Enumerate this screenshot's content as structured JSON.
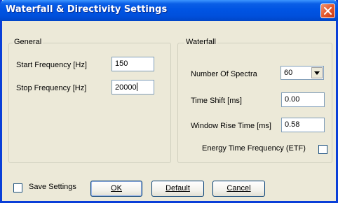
{
  "window": {
    "title": "Waterfall & Directivity Settings"
  },
  "general": {
    "legend": "General",
    "start_frequency_label": "Start Frequency [Hz]",
    "start_frequency_value": "150",
    "stop_frequency_label": "Stop Frequency [Hz]",
    "stop_frequency_value": "20000"
  },
  "waterfall": {
    "legend": "Waterfall",
    "number_of_spectra_label": "Number Of Spectra",
    "number_of_spectra_value": "60",
    "time_shift_label": "Time Shift [ms]",
    "time_shift_value": "0.00",
    "window_rise_time_label": "Window Rise Time [ms]",
    "window_rise_time_value": "0.58",
    "etf_label": "Energy Time Frequency (ETF)",
    "etf_checked": false
  },
  "footer": {
    "save_settings_label": "Save Settings",
    "save_settings_checked": false,
    "ok_label": "OK",
    "default_label": "Default",
    "cancel_label": "Cancel"
  },
  "icons": {
    "close": "close-icon",
    "dropdown": "chevron-down-icon"
  },
  "colors": {
    "titlebar": "#0054e3",
    "dialog_background": "#ece9d8",
    "close_button": "#e4592f",
    "input_border": "#7f9db9"
  }
}
